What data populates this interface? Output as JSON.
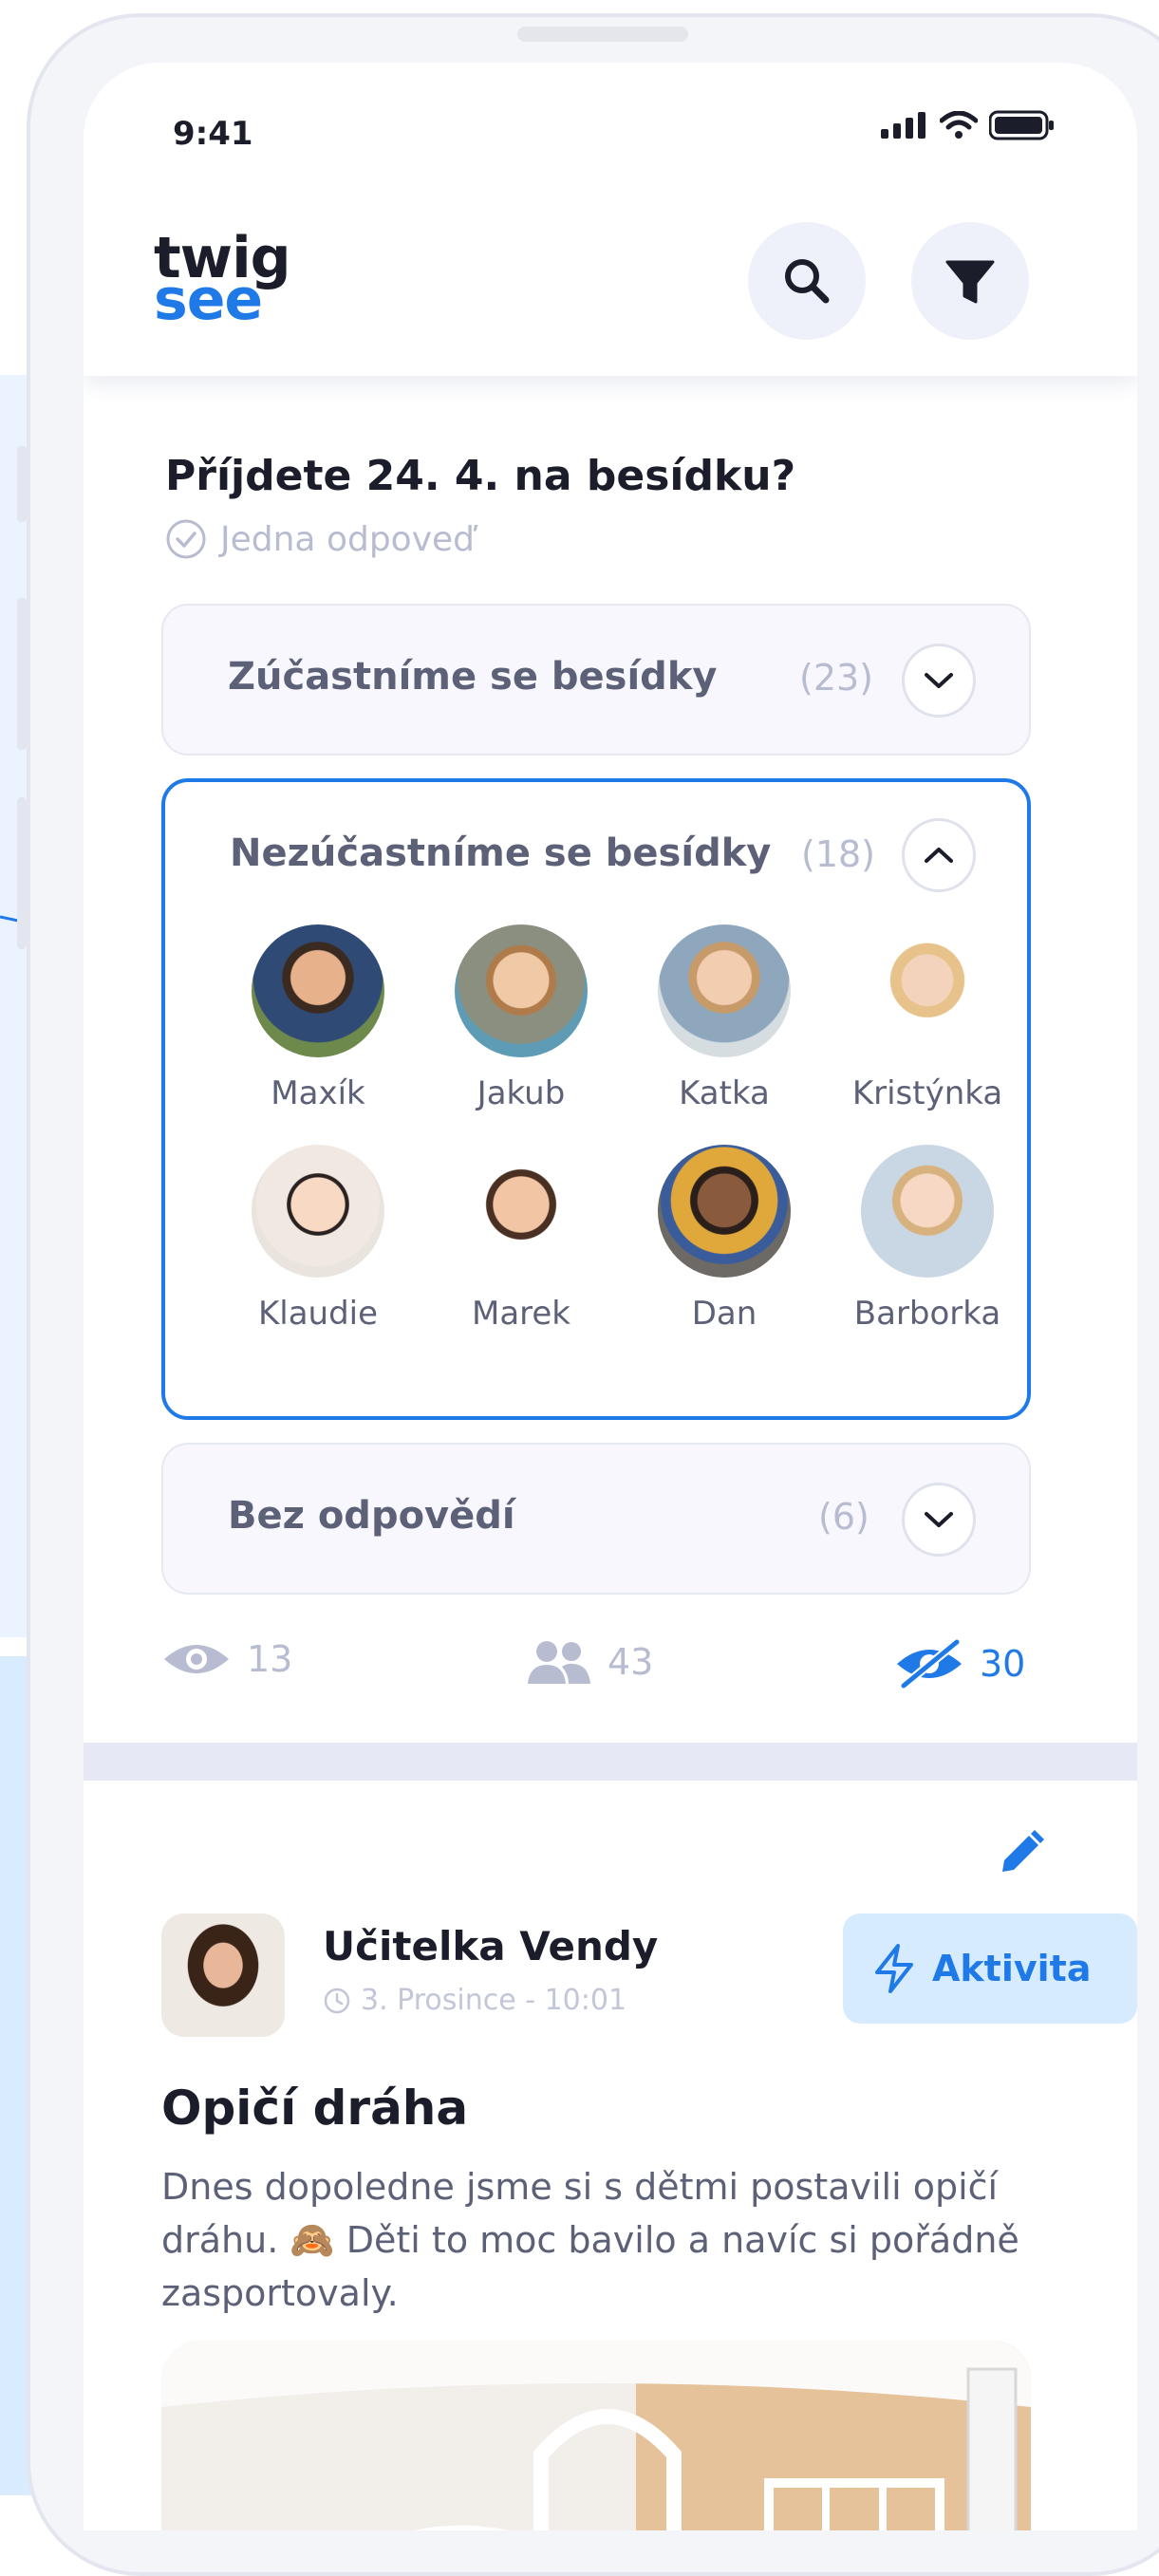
{
  "status_bar": {
    "time": "9:41"
  },
  "brand": {
    "line1": "twig",
    "line2": "see"
  },
  "header": {
    "search_icon": "search-icon",
    "filter_icon": "filter-icon"
  },
  "poll": {
    "question": "Příjdete 24. 4. na besídku?",
    "answer_type": "Jedna odpoveď",
    "options": [
      {
        "label": "Zúčastníme se besídky",
        "count": "(23)",
        "expanded": false
      },
      {
        "label": "Nezúčastníme se besídky",
        "count": "(18)",
        "expanded": true
      },
      {
        "label": "Bez odpovědí",
        "count": "(6)",
        "expanded": false
      }
    ],
    "respondents": [
      {
        "name": "Maxík"
      },
      {
        "name": "Jakub"
      },
      {
        "name": "Katka"
      },
      {
        "name": "Kristýnka"
      },
      {
        "name": "Klaudie"
      },
      {
        "name": "Marek"
      },
      {
        "name": "Dan"
      },
      {
        "name": "Barborka"
      }
    ],
    "stats": {
      "seen": "13",
      "members": "43",
      "not_seen": "30"
    }
  },
  "post": {
    "author": "Učitelka Vendy",
    "time": "3. Prosince - 10:01",
    "badge": "Aktivita",
    "title": "Opičí dráha",
    "body": "Dnes dopoledne jsme si s dětmi postavili opičí dráhu. 🙈 Děti to moc bavilo a navíc si pořádně zasportovaly."
  },
  "colors": {
    "accent": "#1f7ae8",
    "text": "#1b1d2a",
    "muted": "#b8bcd0",
    "badge_bg": "#d7ebff"
  }
}
